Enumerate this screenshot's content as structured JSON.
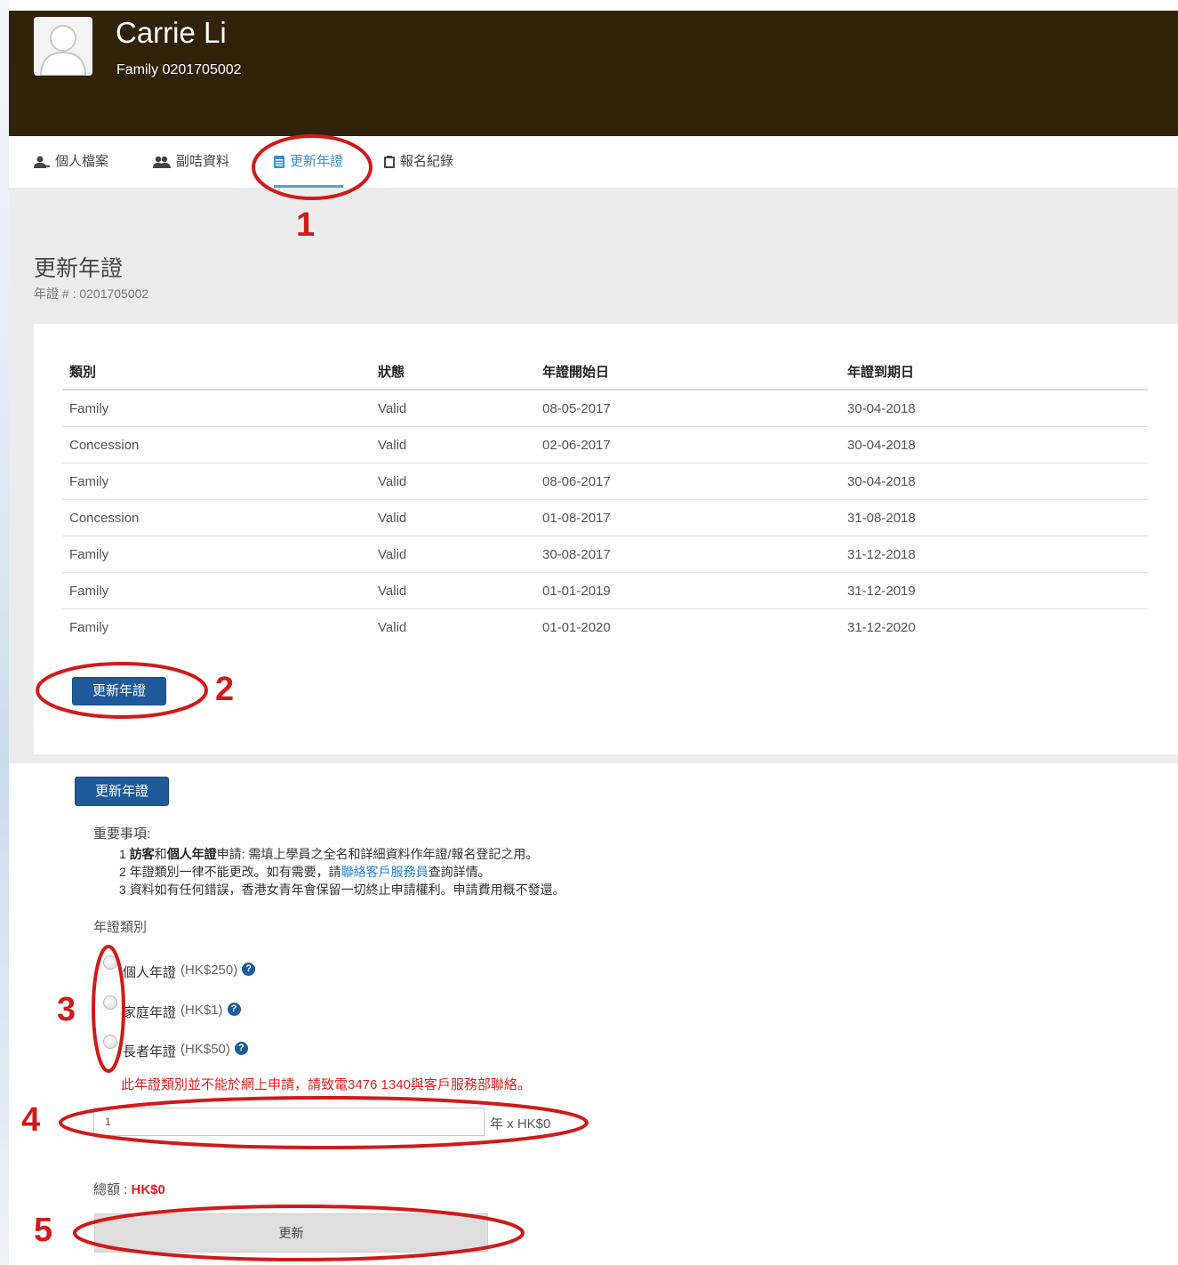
{
  "header": {
    "name": "Carrie Li",
    "membership": "Family 0201705002"
  },
  "nav": {
    "tabs": [
      {
        "label": "個人檔案",
        "icon": "user-icon"
      },
      {
        "label": "副咭資料",
        "icon": "users-icon"
      },
      {
        "label": "更新年證",
        "icon": "document-icon",
        "active": true
      },
      {
        "label": "報名紀錄",
        "icon": "clipboard-icon"
      }
    ]
  },
  "page": {
    "title": "更新年證",
    "subtitle": "年證 # : 0201705002"
  },
  "table": {
    "headers": [
      "類別",
      "狀態",
      "年證開始日",
      "年證到期日"
    ],
    "rows": [
      [
        "Family",
        "Valid",
        "08-05-2017",
        "30-04-2018"
      ],
      [
        "Concession",
        "Valid",
        "02-06-2017",
        "30-04-2018"
      ],
      [
        "Family",
        "Valid",
        "08-06-2017",
        "30-04-2018"
      ],
      [
        "Concession",
        "Valid",
        "01-08-2017",
        "31-08-2018"
      ],
      [
        "Family",
        "Valid",
        "30-08-2017",
        "31-12-2018"
      ],
      [
        "Family",
        "Valid",
        "01-01-2019",
        "31-12-2019"
      ],
      [
        "Family",
        "Valid",
        "01-01-2020",
        "31-12-2020"
      ]
    ]
  },
  "buttons": {
    "renew_label": "更新年證",
    "renew_label_2": "更新年證",
    "submit_label": "更新"
  },
  "notes": {
    "title": "重要事項:",
    "line1_prefix": "1 ",
    "line1_bold1": "訪客",
    "line1_mid": "和",
    "line1_bold2": "個人年證",
    "line1_rest": "申請: 需填上學員之全名和詳細資料作年證/報名登記之用。",
    "line2_prefix": "2 年證類別一律不能更改。如有需要，請",
    "line2_link": "聯絡客戶服務員",
    "line2_suffix": "查詢詳情。",
    "line3": "3 資料如有任何錯誤，香港女青年會保留一切終止申請權利。申請費用概不發還。"
  },
  "membership_type": {
    "label": "年證類別",
    "options": [
      {
        "label": "個人年證",
        "price": "(HK$250)"
      },
      {
        "label": "家庭年證",
        "price": "(HK$1)"
      },
      {
        "label": "長者年證",
        "price": "(HK$50)"
      }
    ],
    "help_glyph": "?"
  },
  "warning": "此年證類別並不能於網上申請，請致電3476 1340與客戶服務部聯絡。",
  "quantity": {
    "value": "1",
    "suffix": "年 x HK$0"
  },
  "total": {
    "label": "總額 : ",
    "amount": "HK$0"
  },
  "annotations": {
    "numbers": [
      "1",
      "2",
      "3",
      "4",
      "5"
    ],
    "color": "#d11a1a"
  },
  "colors": {
    "header_bg": "#30220b",
    "active_tab": "#3a8fd6",
    "button_bg": "#1f5b9a",
    "warning": "#e02020"
  }
}
